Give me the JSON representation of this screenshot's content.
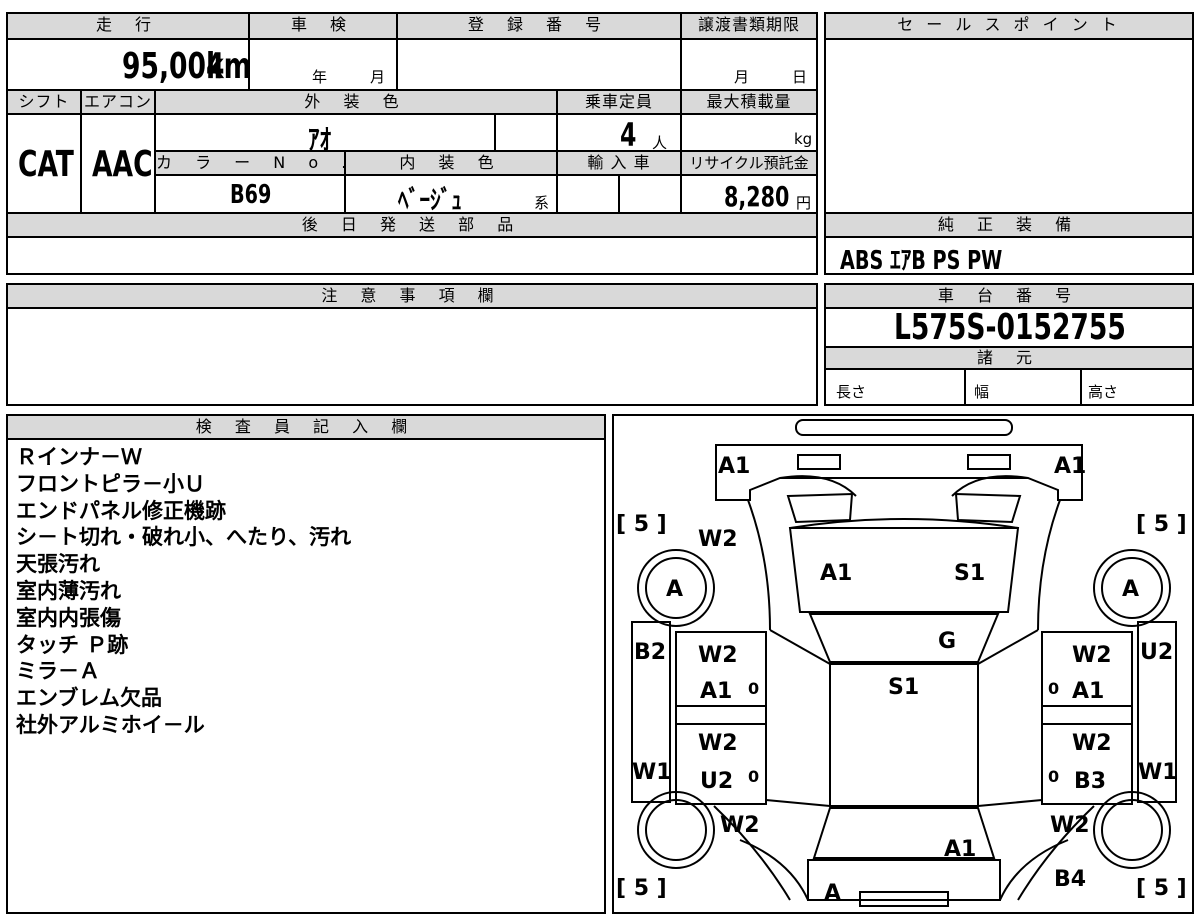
{
  "labels": {
    "mileage": "走 行",
    "inspection": "車 検",
    "registration": "登 録 番 号",
    "transfer_deadline": "譲渡書類期限",
    "sales_point": "セ ー ル ス ポ イ ン ト",
    "shift": "シフト",
    "aircon": "エアコン",
    "exterior_color": "外 装 色",
    "capacity": "乗車定員",
    "max_load": "最大積載量",
    "color_no": "カ ラ ー N o .",
    "interior_color": "内 装 色",
    "import": "輸 入 車",
    "recycle": "リサイクル預託金",
    "later_parts": "後 日 発 送 部 品",
    "oem_equipment": "純 正 装 備",
    "notes": "注 意 事 項 欄",
    "chassis_no": "車 台 番 号",
    "specs": "諸 元",
    "length": "長さ",
    "width": "幅",
    "height": "高さ",
    "inspector": "検 査 員 記 入 欄"
  },
  "values": {
    "mileage": "95,004",
    "mileage_unit": "km",
    "year_unit": "年",
    "month_unit": "月",
    "deadline_month": "月",
    "deadline_day": "日",
    "shift": "CAT",
    "aircon": "AAC",
    "exterior_color": "ｱｵ",
    "capacity": "4",
    "capacity_unit": "人",
    "load_unit": "kg",
    "color_no": "B69",
    "interior_color": "ﾍﾞｰｼﾞｭ",
    "interior_suffix": "系",
    "recycle": "8,280",
    "recycle_unit": "円",
    "oem_equipment": "ABS ｴｱB PS PW",
    "chassis_no": "L575S-0152755"
  },
  "inspector_notes": [
    "Ｒインナ－Ｗ",
    "フロントピラ－小Ｕ",
    "エンドパネル修正機跡",
    "シ－ト切れ・破れ小、へたり、汚れ",
    "天張汚れ",
    "室内薄汚れ",
    "室内内張傷",
    "タッチ Ｐ跡",
    "ミラ－Ａ",
    "エンブレム欠品",
    "社外アルミホイ－ル"
  ],
  "diagram": {
    "front_left": "A1",
    "front_right": "A1",
    "tire_fl": "[ 5 ]",
    "tire_fr": "[ 5 ]",
    "tire_rl": "[ 5 ]",
    "tire_rr": "[ 5 ]",
    "fender_l": "W2",
    "wheel_fl": "A",
    "wheel_fr": "A",
    "hood_l": "A1",
    "hood_r": "S1",
    "windshield": "G",
    "roof": "S1",
    "side_l": "B2",
    "side_r": "U2",
    "door_fl_1": "W2",
    "door_fl_2": "A1",
    "door_fl_mark": "0",
    "door_fr_1": "W2",
    "door_fr_2": "A1",
    "door_fr_mark": "0",
    "door_rl_1": "W2",
    "door_rl_2": "U2",
    "door_rl_mark": "0",
    "door_rr_1": "W2",
    "door_rr_2": "B3",
    "door_rr_mark": "0",
    "rocker_l": "W1",
    "rocker_r": "W1",
    "quarter_l": "W2",
    "quarter_r": "W2",
    "trunk": "A1",
    "rear_corner_r": "B4",
    "rear_bumper": "A"
  }
}
